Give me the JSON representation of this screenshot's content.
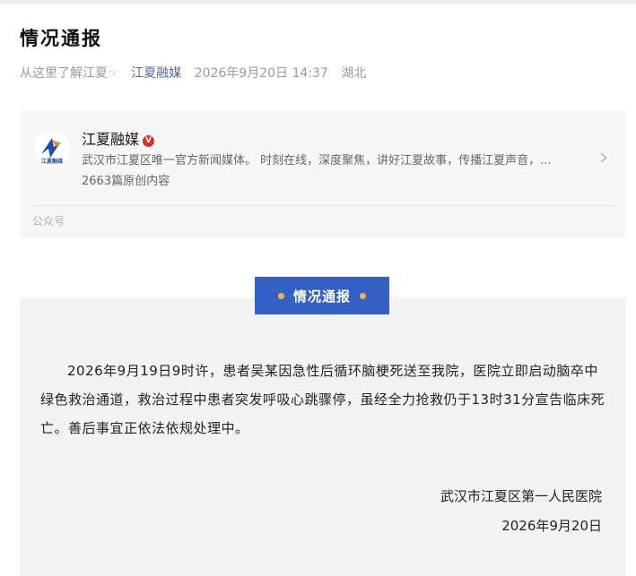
{
  "article": {
    "title": "情况通报",
    "meta": {
      "location_prompt": "从这里了解江夏",
      "hand_icon": "☞",
      "account_link": "江夏融媒",
      "datetime": "2026年9月20日 14:37",
      "region": "湖北"
    }
  },
  "account_card": {
    "name": "江夏融媒",
    "verified_badge": "V",
    "description": "武汉市江夏区唯一官方新闻媒体。 时刻在线，深度聚焦，讲好江夏故事，传播江夏声音，...",
    "original_count": "2663篇原创内容",
    "footer_label": "公众号",
    "logo_text": "江夏融媒",
    "colors": {
      "badge": "#e02e24",
      "logo_blue": "#1e4ea8",
      "logo_orange": "#f08a1d"
    }
  },
  "notice": {
    "banner_label": "情况通报",
    "body": "2026年9月19日9时许，患者吴某因急性后循环脑梗死送至我院，医院立即启动脑卒中绿色救治通道，救治过程中患者突发呼吸心跳骤停，虽经全力抢救仍于13时31分宣告临床死亡。善后事宜正依法依规处理中。",
    "signature_org": "武汉市江夏区第一人民医院",
    "signature_date": "2026年9月20日",
    "colors": {
      "banner": "#3561c4",
      "dot": "#f2b53b"
    }
  }
}
